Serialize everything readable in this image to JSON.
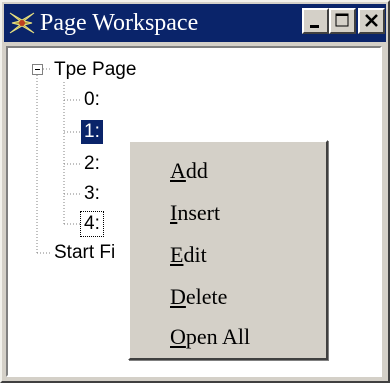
{
  "window": {
    "title": "Page Workspace",
    "buttons": {
      "minimize_icon": "minimize-icon",
      "maximize_icon": "maximize-icon",
      "close_icon": "close-icon"
    }
  },
  "tree": {
    "root": {
      "label": "Tpe Page",
      "expanded": true
    },
    "children": [
      {
        "label": "0:",
        "state": "normal"
      },
      {
        "label": "1:",
        "state": "selected"
      },
      {
        "label": "2:",
        "state": "normal"
      },
      {
        "label": "3:",
        "state": "normal"
      },
      {
        "label": "4:",
        "state": "focused"
      }
    ],
    "second_root": {
      "label": "Start Fi"
    }
  },
  "context_menu": {
    "items": [
      {
        "accel": "A",
        "rest": "dd"
      },
      {
        "accel": "I",
        "rest": "nsert"
      },
      {
        "accel": "E",
        "rest": "dit"
      },
      {
        "accel": "D",
        "rest": "elete"
      },
      {
        "accel": "O",
        "rest": "pen All"
      }
    ]
  },
  "colors": {
    "titlebar": "#0a246a",
    "selection": "#0a246a",
    "face": "#d4d0c8"
  }
}
